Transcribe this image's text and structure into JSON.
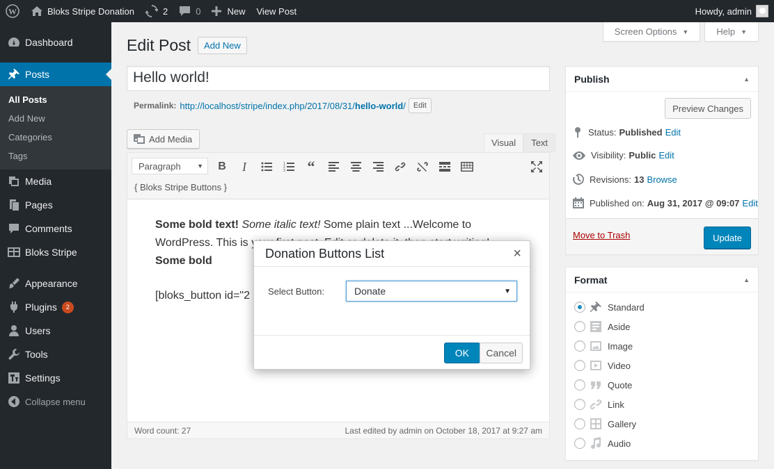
{
  "adminbar": {
    "site_name": "Bloks Stripe Donation",
    "updates_count": "2",
    "comments_count": "0",
    "new_label": "New",
    "view_post_label": "View Post",
    "howdy": "Howdy, admin"
  },
  "sidebar": {
    "items": [
      {
        "label": "Dashboard",
        "icon": "dashboard-icon"
      },
      {
        "label": "Posts",
        "icon": "pushpin-icon"
      },
      {
        "label": "Media",
        "icon": "media-icon"
      },
      {
        "label": "Pages",
        "icon": "pages-icon"
      },
      {
        "label": "Comments",
        "icon": "comments-icon"
      },
      {
        "label": "Bloks Stripe",
        "icon": "bloks-icon"
      },
      {
        "label": "Appearance",
        "icon": "appearance-icon"
      },
      {
        "label": "Plugins",
        "icon": "plugins-icon",
        "badge": "2"
      },
      {
        "label": "Users",
        "icon": "users-icon"
      },
      {
        "label": "Tools",
        "icon": "tools-icon"
      },
      {
        "label": "Settings",
        "icon": "settings-icon"
      },
      {
        "label": "Collapse menu",
        "icon": "collapse-icon"
      }
    ],
    "submenu": [
      "All Posts",
      "Add New",
      "Categories",
      "Tags"
    ]
  },
  "screen_meta": {
    "screen_options": "Screen Options",
    "help": "Help"
  },
  "page": {
    "title": "Edit Post",
    "add_new": "Add New"
  },
  "post": {
    "title": "Hello world!",
    "permalink_label": "Permalink:",
    "permalink_base": "http://localhost/stripe/index.php/2017/08/31/",
    "permalink_slug": "hello-world",
    "permalink_trailing": "/",
    "permalink_edit": "Edit"
  },
  "editor": {
    "add_media": "Add Media",
    "tab_visual": "Visual",
    "tab_text": "Text",
    "format_select": "Paragraph",
    "shortcode_button": "{ Bloks Stripe Buttons }",
    "content_bold1": "Some bold text!",
    "content_italic": " Some italic text!",
    "content_plain": " Some plain text ...Welcome to WordPress. This is your first post. Edit or delete it, then start writing!",
    "content_bold2": " Some bold",
    "content_shortcode": "[bloks_button id=\"2",
    "word_count": "Word count: 27",
    "last_edited": "Last edited by admin on October 18, 2017 at 9:27 am"
  },
  "publish": {
    "heading": "Publish",
    "preview": "Preview Changes",
    "status_label": "Status:",
    "status_value": "Published",
    "visibility_label": "Visibility:",
    "visibility_value": "Public",
    "revisions_label": "Revisions:",
    "revisions_value": "13",
    "browse": "Browse",
    "published_label": "Published on:",
    "published_value": "Aug 31, 2017 @ 09:07",
    "edit": "Edit",
    "trash": "Move to Trash",
    "update": "Update"
  },
  "format_box": {
    "heading": "Format",
    "options": [
      {
        "label": "Standard",
        "icon": "pushpin-icon",
        "checked": true
      },
      {
        "label": "Aside",
        "icon": "aside-icon",
        "checked": false
      },
      {
        "label": "Image",
        "icon": "image-icon",
        "checked": false
      },
      {
        "label": "Video",
        "icon": "video-icon",
        "checked": false
      },
      {
        "label": "Quote",
        "icon": "quote-icon",
        "checked": false
      },
      {
        "label": "Link",
        "icon": "link-icon",
        "checked": false
      },
      {
        "label": "Gallery",
        "icon": "gallery-icon",
        "checked": false
      },
      {
        "label": "Audio",
        "icon": "audio-icon",
        "checked": false
      }
    ]
  },
  "modal": {
    "title": "Donation Buttons List",
    "close": "×",
    "select_label": "Select Button:",
    "select_value": "Donate",
    "ok": "OK",
    "cancel": "Cancel"
  },
  "colors": {
    "accent": "#0073aa",
    "button_primary": "#0085ba",
    "adminbar": "#23282d",
    "badge": "#ca4a1f"
  }
}
